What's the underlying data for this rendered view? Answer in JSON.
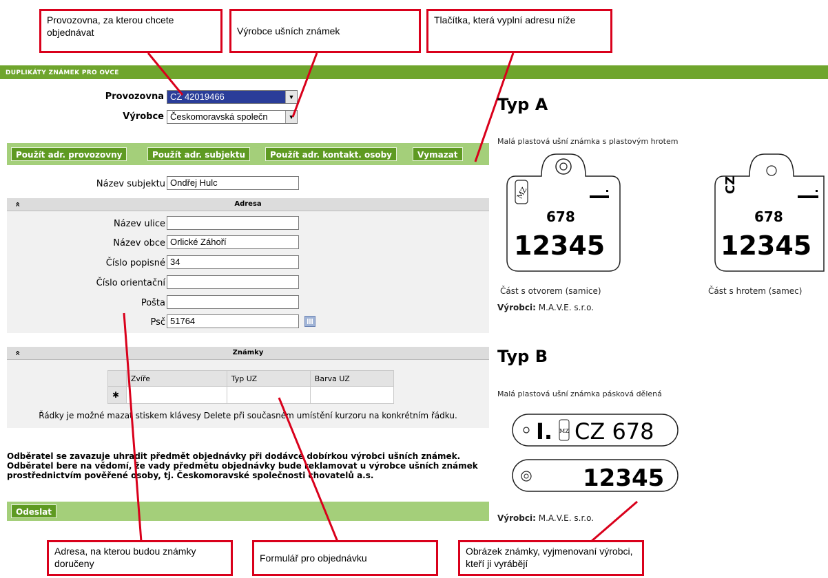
{
  "callouts": {
    "provozovna": "Provozovna, za kterou chcete objednávat",
    "vyrobce": "Výrobce ušních známek",
    "tlacitka": "Tlačítka, která vyplní adresu níže",
    "adresa": "Adresa, na kterou budou známky doručeny",
    "formular": "Formulář pro objednávku",
    "obrazek": "Obrázek známky, vyjmenovaní výrobci, kteří ji vyrábějí"
  },
  "header": {
    "title": "Duplikáty známek pro ovce"
  },
  "form": {
    "provozovna_label": "Provozovna",
    "provozovna_value": "CZ 42019466",
    "vyrobce_label": "Výrobce",
    "vyrobce_value": "Českomoravská společn"
  },
  "buttons": {
    "adr_provozovny": "Použít adr. provozovny",
    "adr_subjektu": "Použít adr. subjektu",
    "adr_kontakt": "Použít adr. kontakt. osoby",
    "vymazat": "Vymazat",
    "odeslat": "Odeslat"
  },
  "subjekt": {
    "label": "Název subjektu",
    "value": "Ondřej Hulc"
  },
  "adresa": {
    "title": "Adresa",
    "collapse": "«",
    "ulice_label": "Název ulice",
    "ulice_value": "",
    "obec_label": "Název obce",
    "obec_value": "Orlické Záhoří",
    "popisne_label": "Číslo popisné",
    "popisne_value": "34",
    "orientacni_label": "Číslo orientační",
    "orientacni_value": "",
    "posta_label": "Pošta",
    "posta_value": "",
    "psc_label": "Psč",
    "psc_value": "51764"
  },
  "znamky": {
    "title": "Známky",
    "collapse": "«",
    "columns": [
      "Zvíře",
      "Typ UZ",
      "Barva UZ"
    ],
    "new_row_marker": "✱",
    "hint": "Řádky je možné mazat stiskem klávesy Delete při současném umístění kurzoru na konkrétním řádku."
  },
  "note": "Odběratel se zavazuje uhradit předmět objednávky při dodávce dobírkou výrobci ušních známek. Odběratel bere na vědomí, že vady předmětu objednávky bude reklamovat u výrobce ušních známek prostřednictvím pověřené osoby, tj. Českomoravské společnosti chovatelů a.s.",
  "typ_a": {
    "title": "Typ A",
    "desc": "Malá plastová ušní známka s plastovým hrotem",
    "tag_female": {
      "top": "678",
      "number": "12345",
      "logo": "MZ",
      "caption": "Část s otvorem (samice)"
    },
    "tag_male": {
      "country": "CZ",
      "top": "678",
      "number": "12345",
      "caption": "Část s hrotem (samec)"
    },
    "vyrobci_label": "Výrobci:",
    "vyrobci_value": "M.A.V.E. s.r.o."
  },
  "typ_b": {
    "title": "Typ B",
    "desc": "Malá plastová ušní známka pásková dělená",
    "tag_top": {
      "roman": "I.",
      "logo": "MZ",
      "country_code": "CZ 678"
    },
    "tag_bottom": {
      "number": "12345"
    },
    "vyrobci_label": "Výrobci:",
    "vyrobci_value": "M.A.V.E. s.r.o."
  },
  "colors": {
    "green": "#6fa52d",
    "button": "#5e9a22",
    "callout": "#d9001b",
    "select_highlight": "#2a3d99"
  }
}
